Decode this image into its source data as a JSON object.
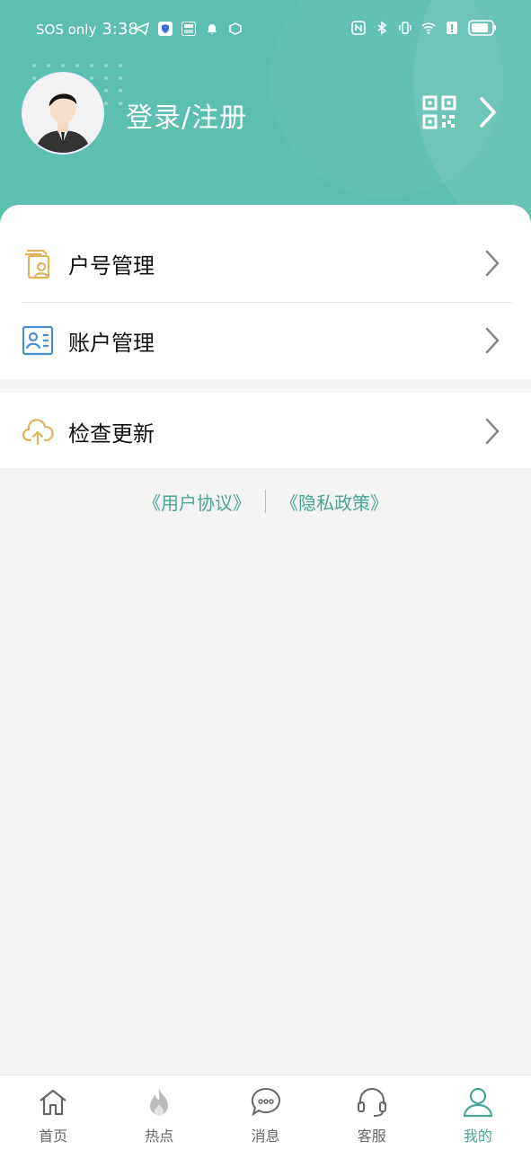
{
  "status_bar": {
    "carrier": "SOS only",
    "time": "3:38"
  },
  "profile": {
    "login_label": "登录/注册"
  },
  "menu_group1": [
    {
      "label": "户号管理",
      "icon": "account-number-icon"
    },
    {
      "label": "账户管理",
      "icon": "id-card-icon"
    }
  ],
  "menu_group2": [
    {
      "label": "检查更新",
      "icon": "cloud-upload-icon"
    }
  ],
  "footer_links": {
    "user_agreement": "《用户协议》",
    "privacy_policy": "《隐私政策》"
  },
  "tabs": [
    {
      "label": "首页",
      "icon": "home-icon",
      "active": false
    },
    {
      "label": "热点",
      "icon": "fire-icon",
      "active": false
    },
    {
      "label": "消息",
      "icon": "message-icon",
      "active": false
    },
    {
      "label": "客服",
      "icon": "headset-icon",
      "active": false
    },
    {
      "label": "我的",
      "icon": "user-icon",
      "active": true
    }
  ],
  "colors": {
    "brand": "#5dbfae",
    "accent_text": "#4aa597",
    "icon_gold": "#e0b35c",
    "icon_blue": "#4a8fd0"
  }
}
